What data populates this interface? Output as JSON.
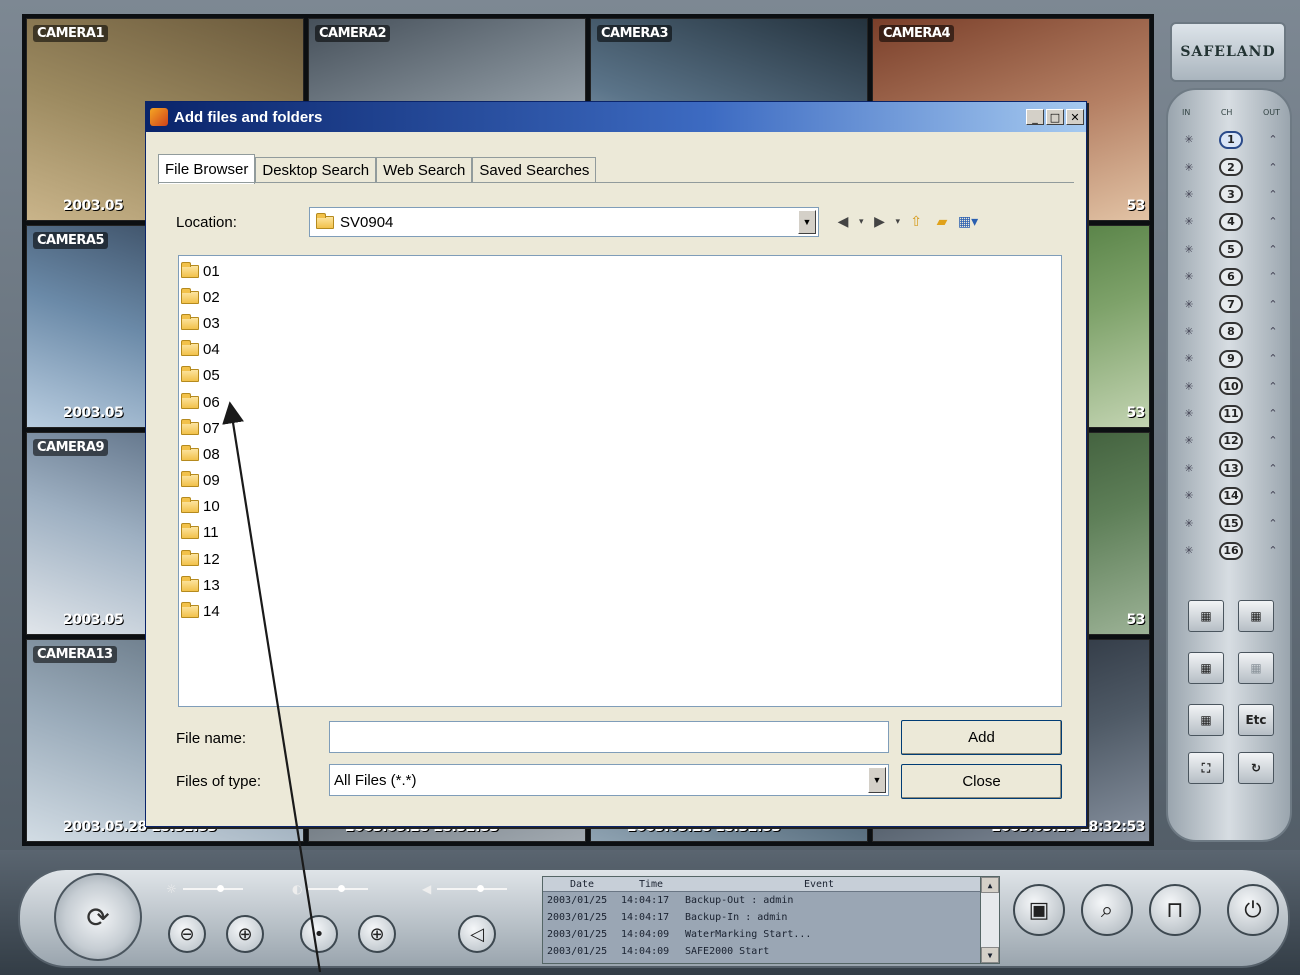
{
  "cameras": [
    {
      "label": "CAMERA1",
      "ts": "2003.05",
      "colors": [
        "#6b5a3c",
        "#9c8a60",
        "#c9b48a"
      ]
    },
    {
      "label": "CAMERA2",
      "ts": "",
      "colors": [
        "#46505a",
        "#8b969f",
        "#c7ced4"
      ]
    },
    {
      "label": "CAMERA3",
      "ts": "",
      "colors": [
        "#24323d",
        "#5b7489",
        "#b4c4d3"
      ]
    },
    {
      "label": "CAMERA4",
      "ts": "53",
      "colors": [
        "#7a3f2a",
        "#b58064",
        "#e2c3a5"
      ]
    },
    {
      "label": "CAMERA5",
      "ts": "2003.05",
      "colors": [
        "#2d3c50",
        "#6b8aa8",
        "#b9cde0"
      ]
    },
    {
      "label": "",
      "ts": "",
      "colors": [
        "#5a6a70",
        "#9aa7ac",
        "#c8d0d3"
      ]
    },
    {
      "label": "",
      "ts": "",
      "colors": [
        "#324450",
        "#6c8494",
        "#a6b8c3"
      ]
    },
    {
      "label": "",
      "ts": "53",
      "colors": [
        "#3c6b2d",
        "#7ea26a",
        "#c3d4b2"
      ]
    },
    {
      "label": "CAMERA9",
      "ts": "2003.05",
      "colors": [
        "#4a5d74",
        "#9eb0c2",
        "#e0e5ea"
      ]
    },
    {
      "label": "",
      "ts": "",
      "colors": [
        "#2f3b42",
        "#6d7a80",
        "#a7b1b6"
      ]
    },
    {
      "label": "",
      "ts": "",
      "colors": [
        "#3b4a52",
        "#7a8890",
        "#b6c0c5"
      ]
    },
    {
      "label": "",
      "ts": "53",
      "colors": [
        "#2d4a2a",
        "#5e7f58",
        "#9cb296"
      ]
    },
    {
      "label": "CAMERA13",
      "ts": "2003.05.28 18:32:53",
      "colors": [
        "#5c6c7a",
        "#9aabba",
        "#d2dce4"
      ]
    },
    {
      "label": "",
      "ts": "2003.05.28 18:32:53",
      "colors": [
        "#3a4148",
        "#6f7880",
        "#a2aab1"
      ]
    },
    {
      "label": "",
      "ts": "2003.05.28 18:32:53",
      "colors": [
        "#1d2b36",
        "#4d6374",
        "#8fa3b2"
      ]
    },
    {
      "label": "",
      "ts": "2003.05.28 18:32:53",
      "colors": [
        "#1e2530",
        "#4f5a66",
        "#8892a0"
      ]
    }
  ],
  "logo": "SAFELAND",
  "channel_panel": {
    "head_in": "IN",
    "head_mid": "CH",
    "head_out": "OUT",
    "channels": [
      "1",
      "2",
      "3",
      "4",
      "5",
      "6",
      "7",
      "8",
      "9",
      "10",
      "11",
      "12",
      "13",
      "14",
      "15",
      "16"
    ],
    "selected": "1"
  },
  "layout_buttons": [
    {
      "glyph": "▦",
      "dim": false
    },
    {
      "glyph": "▦",
      "dim": false
    },
    {
      "glyph": "▦",
      "dim": false
    },
    {
      "glyph": "▦",
      "dim": true
    },
    {
      "glyph": "▦",
      "dim": false
    },
    {
      "glyph": "Etc",
      "dim": false
    },
    {
      "glyph": "⛶",
      "dim": false
    },
    {
      "glyph": "↻",
      "dim": false
    }
  ],
  "event_log": {
    "headers": [
      "Date",
      "Time",
      "Event"
    ],
    "rows": [
      [
        "2003/01/25",
        "14:04:17",
        "Backup-Out : admin"
      ],
      [
        "2003/01/25",
        "14:04:17",
        "Backup-In : admin"
      ],
      [
        "2003/01/25",
        "14:04:09",
        "WaterMarking Start..."
      ],
      [
        "2003/01/25",
        "14:04:09",
        "SAFE2000 Start"
      ]
    ]
  },
  "dialog": {
    "title": "Add files and folders",
    "tabs": [
      "File Browser",
      "Desktop Search",
      "Web Search",
      "Saved Searches"
    ],
    "active_tab": "File Browser",
    "location_label": "Location:",
    "location_value": "SV0904",
    "folders": [
      "01",
      "02",
      "03",
      "04",
      "05",
      "06",
      "07",
      "08",
      "09",
      "10",
      "11",
      "12",
      "13",
      "14"
    ],
    "file_name_label": "File name:",
    "file_name_value": "",
    "files_of_type_label": "Files of type:",
    "files_of_type_value": "All Files (*.*)",
    "add_label": "Add",
    "close_label": "Close"
  },
  "colors": {
    "titlebar": "#0a246a",
    "dialog_bg": "#ece9d8",
    "list_border": "#7f9db9"
  }
}
